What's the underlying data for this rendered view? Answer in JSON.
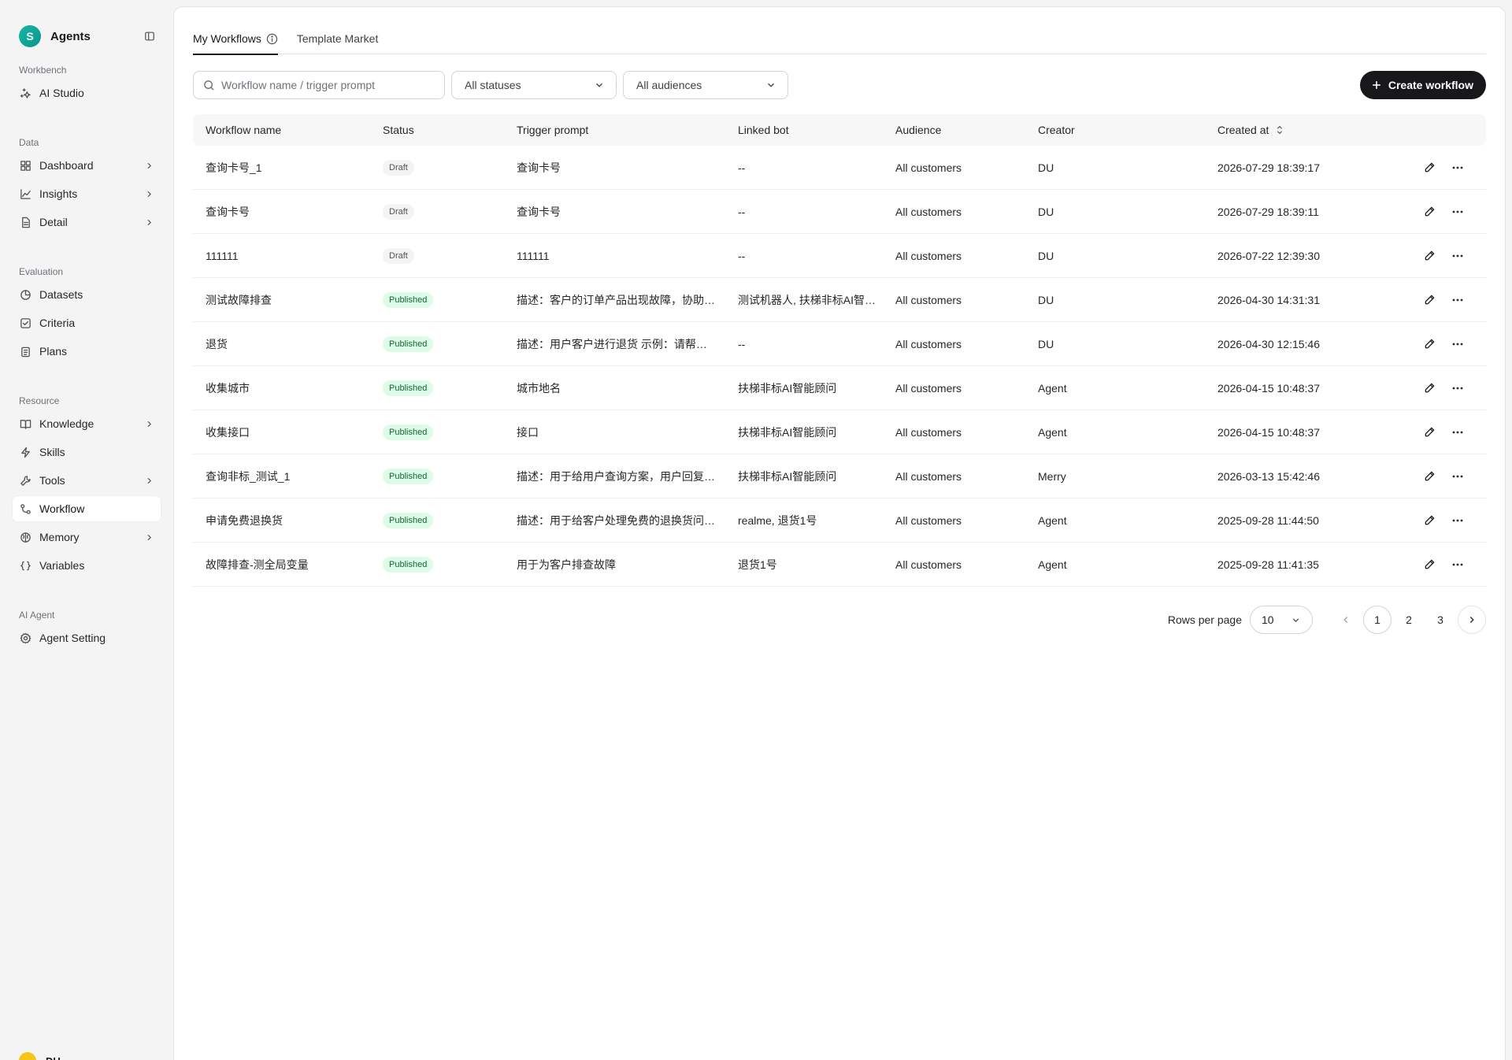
{
  "brand": {
    "initial": "S",
    "name": "Agents"
  },
  "sidebar": {
    "sections": [
      {
        "title": "Workbench",
        "items": [
          {
            "label": "AI Studio",
            "icon": "sparkles-icon",
            "chevron": false
          }
        ]
      },
      {
        "title": "Data",
        "items": [
          {
            "label": "Dashboard",
            "icon": "dashboard-icon",
            "chevron": true
          },
          {
            "label": "Insights",
            "icon": "line-chart-icon",
            "chevron": true
          },
          {
            "label": "Detail",
            "icon": "file-icon",
            "chevron": true
          }
        ]
      },
      {
        "title": "Evaluation",
        "items": [
          {
            "label": "Datasets",
            "icon": "database-icon",
            "chevron": false
          },
          {
            "label": "Criteria",
            "icon": "check-square-icon",
            "chevron": false
          },
          {
            "label": "Plans",
            "icon": "clipboard-icon",
            "chevron": false
          }
        ]
      },
      {
        "title": "Resource",
        "items": [
          {
            "label": "Knowledge",
            "icon": "book-icon",
            "chevron": true
          },
          {
            "label": "Skills",
            "icon": "zap-icon",
            "chevron": false
          },
          {
            "label": "Tools",
            "icon": "wrench-icon",
            "chevron": true
          },
          {
            "label": "Workflow",
            "icon": "workflow-icon",
            "chevron": false,
            "active": true
          },
          {
            "label": "Memory",
            "icon": "brain-icon",
            "chevron": true
          },
          {
            "label": "Variables",
            "icon": "braces-icon",
            "chevron": false
          }
        ]
      },
      {
        "title": "AI Agent",
        "items": [
          {
            "label": "Agent Setting",
            "icon": "gear-icon",
            "chevron": false
          }
        ]
      }
    ]
  },
  "user": {
    "name": "DU"
  },
  "tabs": [
    {
      "label": "My Workflows",
      "active": true
    },
    {
      "label": "Template Market",
      "active": false
    }
  ],
  "search": {
    "placeholder": "Workflow name / trigger prompt",
    "value": ""
  },
  "filters": {
    "status": "All statuses",
    "audience": "All audiences"
  },
  "create_label": "Create workflow",
  "table": {
    "headers": {
      "name": "Workflow name",
      "status": "Status",
      "trigger": "Trigger prompt",
      "bot": "Linked bot",
      "audience": "Audience",
      "creator": "Creator",
      "created": "Created at"
    },
    "rows": [
      {
        "name": "查询卡号_1",
        "status": "Draft",
        "trigger": "查询卡号",
        "bot": "--",
        "audience": "All customers",
        "creator": "DU",
        "created": "2026-07-29 18:39:17"
      },
      {
        "name": "查询卡号",
        "status": "Draft",
        "trigger": "查询卡号",
        "bot": "--",
        "audience": "All customers",
        "creator": "DU",
        "created": "2026-07-29 18:39:11"
      },
      {
        "name": "111111",
        "status": "Draft",
        "trigger": "111111",
        "bot": "--",
        "audience": "All customers",
        "creator": "DU",
        "created": "2026-07-22 12:39:30"
      },
      {
        "name": "测试故障排查",
        "status": "Published",
        "trigger": "描述：客户的订单产品出现故障，协助…",
        "bot": "测试机器人, 扶梯非标AI智…",
        "audience": "All customers",
        "creator": "DU",
        "created": "2026-04-30 14:31:31"
      },
      {
        "name": "退货",
        "status": "Published",
        "trigger": "描述：用户客户进行退货 示例：请帮…",
        "bot": "--",
        "audience": "All customers",
        "creator": "DU",
        "created": "2026-04-30 12:15:46"
      },
      {
        "name": "收集城市",
        "status": "Published",
        "trigger": "城市地名",
        "bot": "扶梯非标AI智能顾问",
        "audience": "All customers",
        "creator": "Agent",
        "created": "2026-04-15 10:48:37"
      },
      {
        "name": "收集接口",
        "status": "Published",
        "trigger": "接口",
        "bot": "扶梯非标AI智能顾问",
        "audience": "All customers",
        "creator": "Agent",
        "created": "2026-04-15 10:48:37"
      },
      {
        "name": "查询非标_测试_1",
        "status": "Published",
        "trigger": "描述：用于给用户查询方案，用户回复…",
        "bot": "扶梯非标AI智能顾问",
        "audience": "All customers",
        "creator": "Merry",
        "created": "2026-03-13 15:42:46"
      },
      {
        "name": "申请免费退换货",
        "status": "Published",
        "trigger": "描述：用于给客户处理免费的退换货问…",
        "bot": "realme, 退货1号",
        "audience": "All customers",
        "creator": "Agent",
        "created": "2025-09-28 11:44:50"
      },
      {
        "name": "故障排查-测全局变量",
        "status": "Published",
        "trigger": "用于为客户排查故障",
        "bot": "退货1号",
        "audience": "All customers",
        "creator": "Agent",
        "created": "2025-09-28 11:41:35"
      }
    ]
  },
  "pagination": {
    "rows_per_page_label": "Rows per page",
    "rows_per_page": "10",
    "pages": [
      "1",
      "2",
      "3"
    ],
    "current": "1"
  },
  "colors": {
    "published_bg": "#dcfce7",
    "published_fg": "#166534",
    "draft_bg": "#f4f4f5",
    "accent": "#18181b",
    "brand": "#14b8a6"
  }
}
